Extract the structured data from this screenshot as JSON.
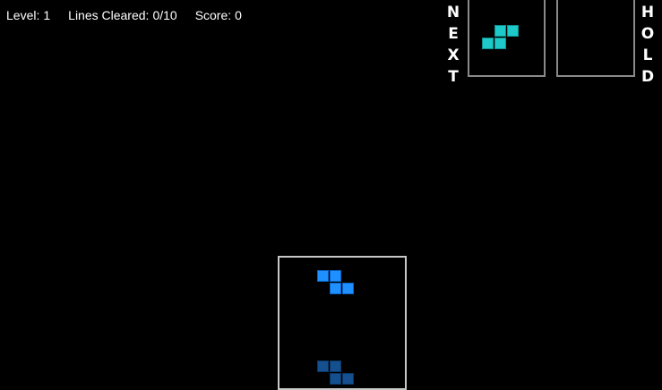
{
  "hud": {
    "level_label": "Level:",
    "level_value": "1",
    "lines_label": "Lines Cleared:",
    "lines_value": "0/10",
    "score_label": "Score:",
    "score_value": "0"
  },
  "next_panel": {
    "label_letters": [
      "N",
      "E",
      "X",
      "T"
    ],
    "piece": "S",
    "piece_color": "#1ec9c9"
  },
  "hold_panel": {
    "label_letters": [
      "H",
      "O",
      "L",
      "D"
    ],
    "piece": null
  },
  "playfield": {
    "active_piece": "Z",
    "active_color": "#1e90ff",
    "ghost_color": "#14508f",
    "border_color": "#c8c8c8"
  }
}
